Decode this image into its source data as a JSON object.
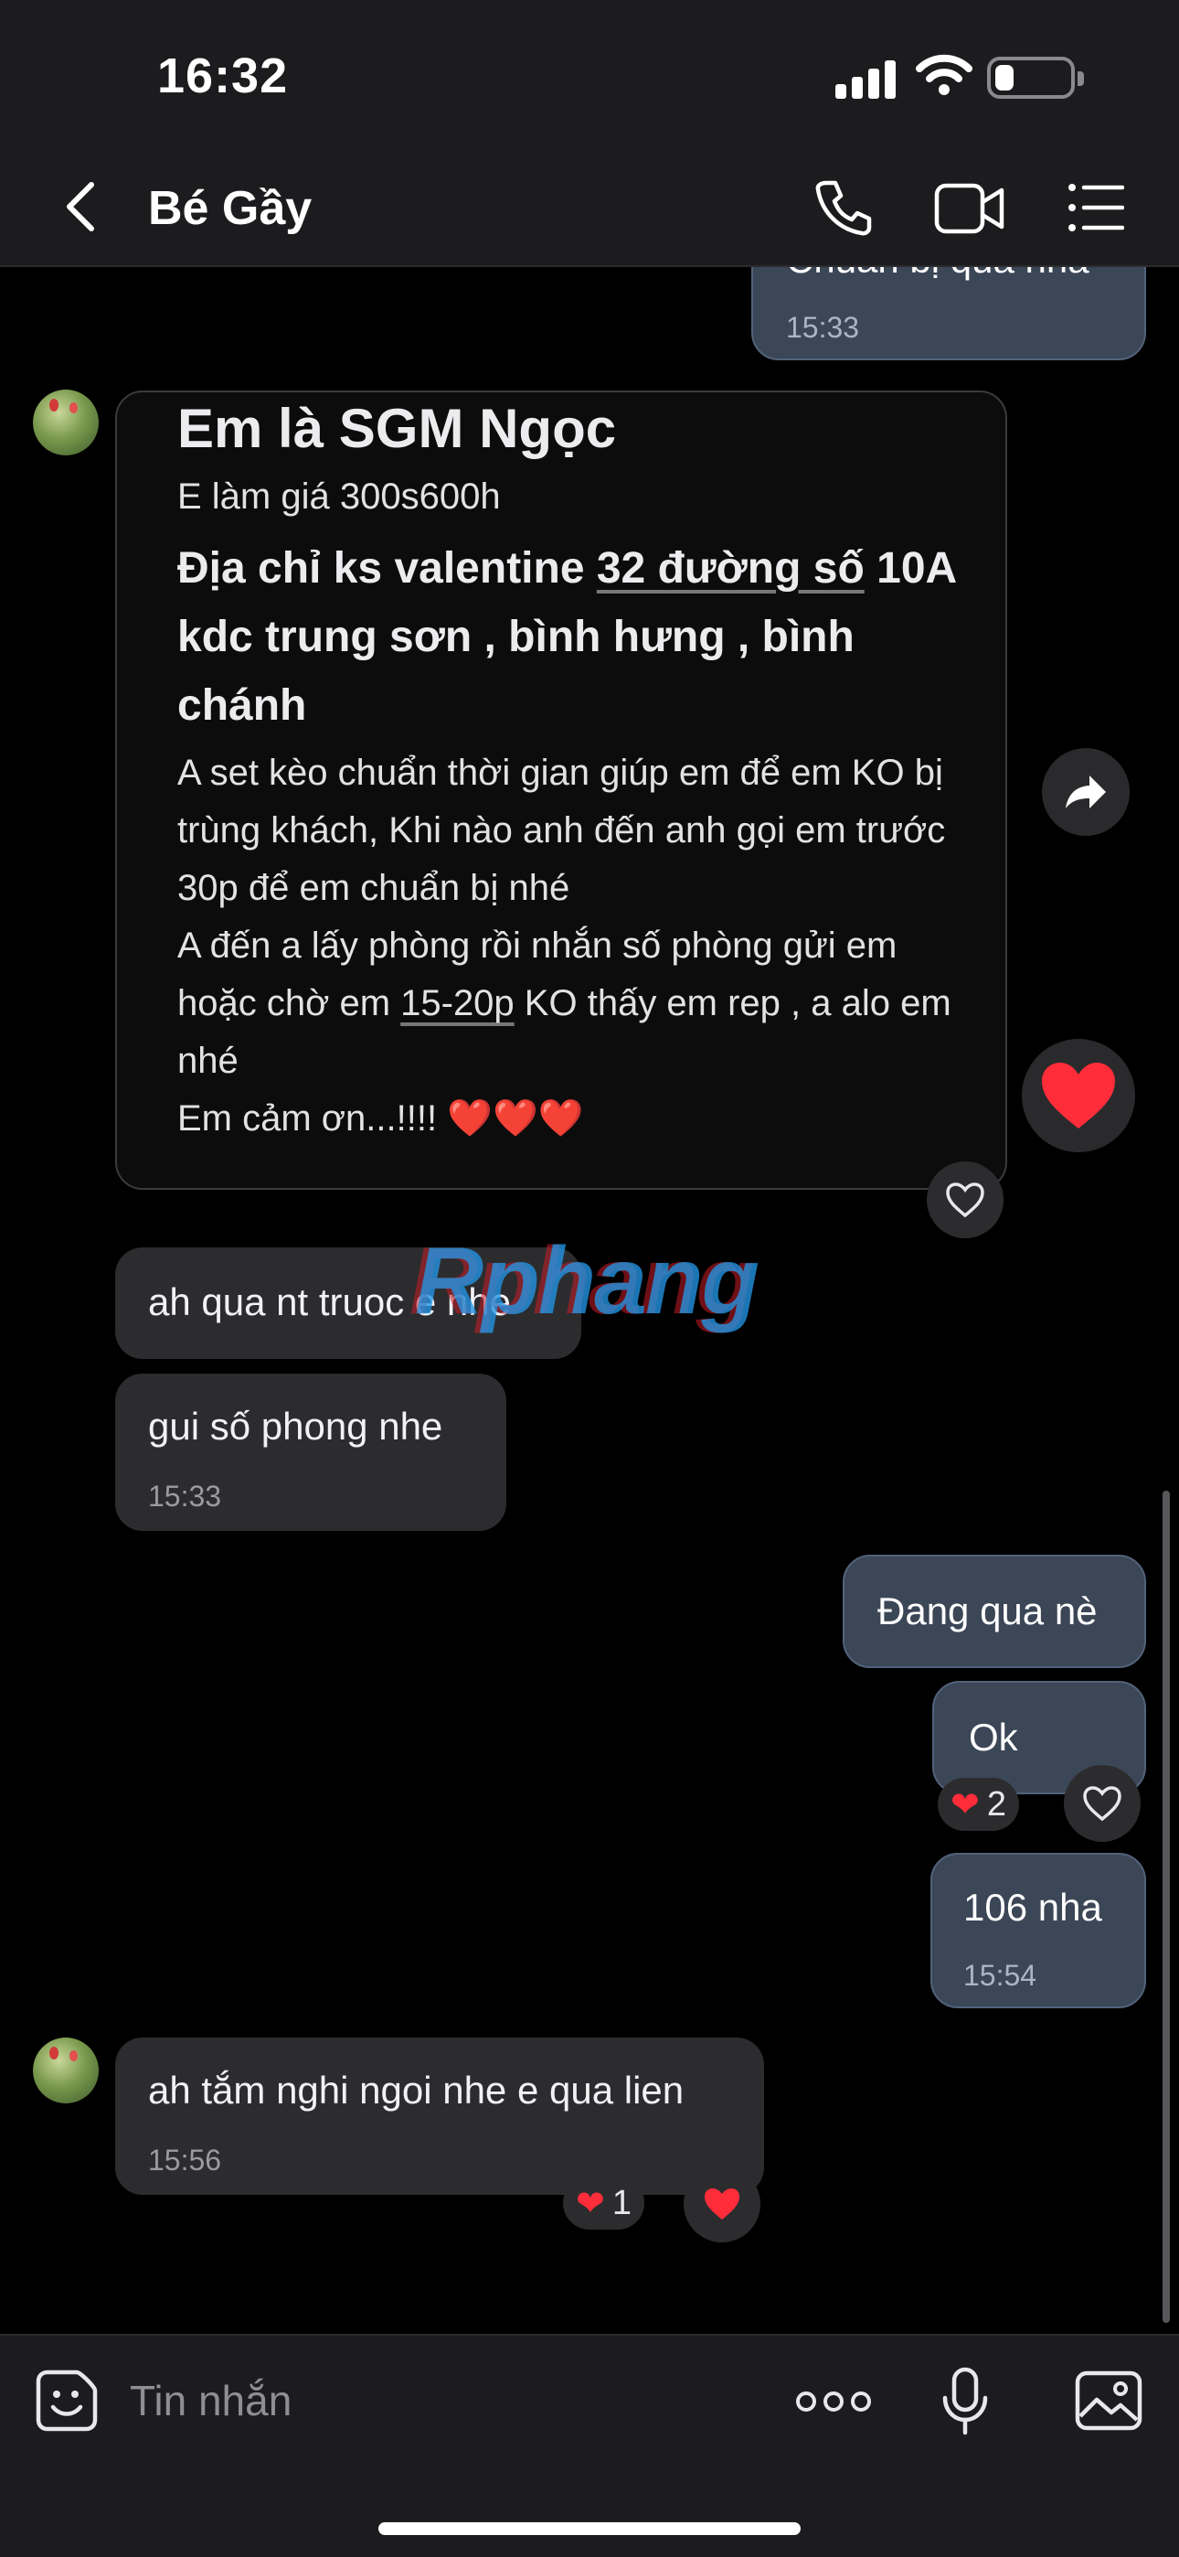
{
  "status_bar": {
    "time": "16:32"
  },
  "header": {
    "contact_name": "Bé Gầy"
  },
  "messages": {
    "m0": {
      "text": "Chuẩn bị qua nha",
      "time": "15:33"
    },
    "card": {
      "title": "Em là SGM Ngọc",
      "price": "E làm giá 300s600h",
      "address_prefix": "Địa chỉ ks valentine ",
      "address_link": "32 đường số",
      "address_rest": "10A kdc trung sơn , bình hưng , bình chánh",
      "line1": "A set kèo chuẩn thời gian giúp em để em KO bị trùng khách,  Khi nào anh đến anh gọi em trước 30p để em chuẩn bị nhé",
      "line2_prefix": "A đến a lấy phòng rồi nhắn số phòng gửi em hoặc chờ em ",
      "line2_link": "15-20p",
      "line2_rest": " KO thấy em rep , a alo em nhé",
      "line3": "Em cảm ơn...!!!! ❤️❤️❤️"
    },
    "m2": {
      "text": "ah qua nt truoc e nhe"
    },
    "m3": {
      "text": "gui số phong nhe",
      "time": "15:33"
    },
    "m4": {
      "text": "Đang qua nè"
    },
    "m5": {
      "text": "Ok",
      "reaction_count": "2"
    },
    "m6": {
      "text": "106 nha",
      "time": "15:54"
    },
    "m7": {
      "text": "ah tắm nghi ngoi nhe e qua lien",
      "time": "15:56",
      "reaction_count": "1"
    }
  },
  "watermark": "Rphang",
  "input": {
    "placeholder": "Tin nhắn"
  },
  "icons": {
    "back": "chevron-left-icon",
    "call": "phone-icon",
    "video": "video-camera-icon",
    "menu": "list-icon",
    "forward": "forward-icon",
    "heart": "heart-icon",
    "sticker": "sticker-icon",
    "more": "more-dots-icon",
    "mic": "microphone-icon",
    "image": "image-icon"
  },
  "colors": {
    "accent_heart": "#ff2d3a",
    "outgoing_bubble": "#3b4656",
    "incoming_bubble": "#2c2c2e"
  }
}
